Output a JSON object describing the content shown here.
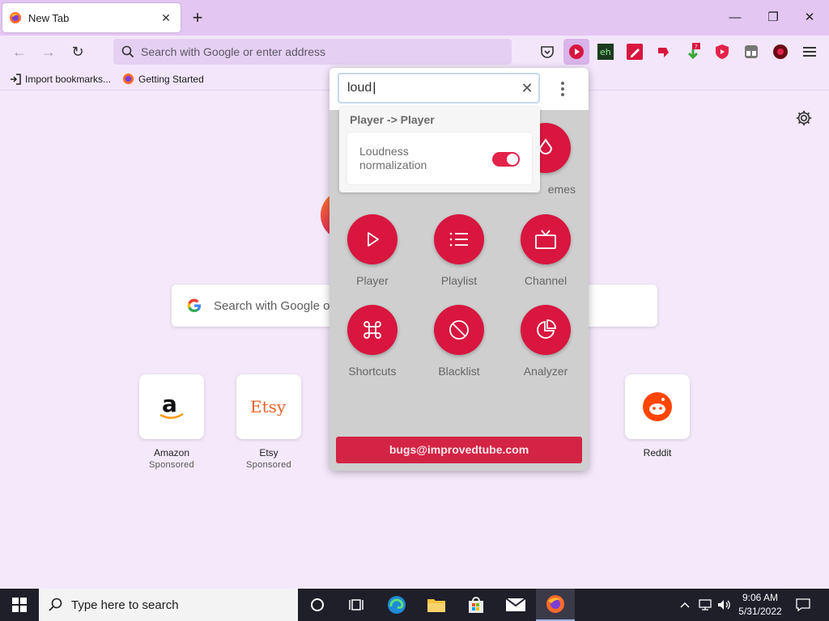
{
  "browser": {
    "tab": {
      "title": "New Tab"
    },
    "url_placeholder": "Search with Google or enter address",
    "bookmarks": [
      {
        "label": "Import bookmarks..."
      },
      {
        "label": "Getting Started"
      }
    ],
    "extensions": [
      "pocket-icon",
      "improvedtube-icon",
      "eh-icon",
      "pencil-icon",
      "thumb-icon",
      "download-icon",
      "shield-icon",
      "scissor-icon",
      "record-icon",
      "menu-icon"
    ]
  },
  "newtab": {
    "search_placeholder": "Search with Google o",
    "tiles": [
      {
        "name": "Amazon",
        "sub": "Sponsored"
      },
      {
        "name": "Etsy",
        "sub": "Sponsored"
      },
      {
        "name": "Reddit",
        "sub": ""
      }
    ]
  },
  "popup": {
    "search_value": "loud",
    "result": {
      "section": "Player -> Player",
      "option_label": "Loudness normalization",
      "toggle_on": true
    },
    "partial_label": "emes",
    "buttons": [
      {
        "label": "Player",
        "icon": "play-icon"
      },
      {
        "label": "Playlist",
        "icon": "list-icon"
      },
      {
        "label": "Channel",
        "icon": "tv-icon"
      },
      {
        "label": "Shortcuts",
        "icon": "command-icon"
      },
      {
        "label": "Blacklist",
        "icon": "block-icon"
      },
      {
        "label": "Analyzer",
        "icon": "pie-icon"
      }
    ],
    "footer": "bugs@improvedtube.com",
    "accent": "#d8163f"
  },
  "taskbar": {
    "search_text": "Type here to search",
    "time": "9:06 AM",
    "date": "5/31/2022"
  }
}
